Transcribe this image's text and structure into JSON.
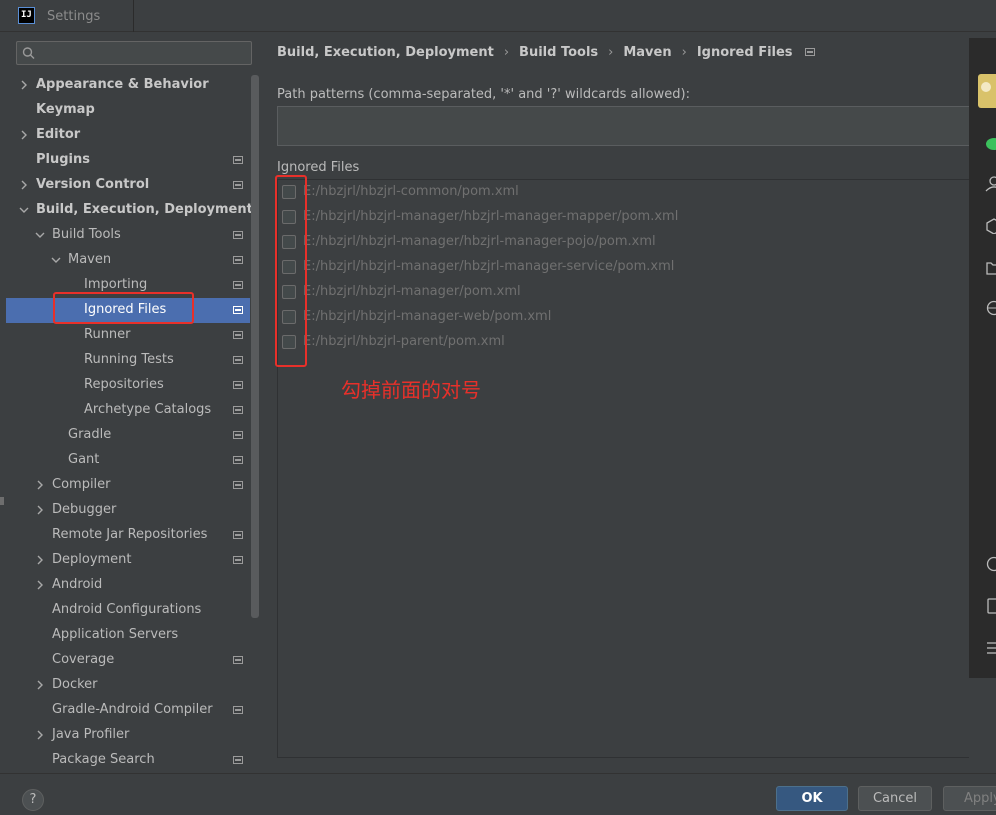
{
  "window": {
    "title": "Settings",
    "logo_text": "IJ"
  },
  "search": {
    "placeholder": "",
    "value": ""
  },
  "tree": [
    {
      "label": "Appearance & Behavior",
      "level": 0,
      "bold": true,
      "arrow": "right",
      "badge": false
    },
    {
      "label": "Keymap",
      "level": 0,
      "bold": true,
      "arrow": "",
      "badge": false
    },
    {
      "label": "Editor",
      "level": 0,
      "bold": true,
      "arrow": "right",
      "badge": false
    },
    {
      "label": "Plugins",
      "level": 0,
      "bold": true,
      "arrow": "",
      "badge": true
    },
    {
      "label": "Version Control",
      "level": 0,
      "bold": true,
      "arrow": "right",
      "badge": true
    },
    {
      "label": "Build, Execution, Deployment",
      "level": 0,
      "bold": true,
      "arrow": "down",
      "badge": false
    },
    {
      "label": "Build Tools",
      "level": 1,
      "bold": false,
      "arrow": "down",
      "badge": true
    },
    {
      "label": "Maven",
      "level": 2,
      "bold": false,
      "arrow": "down",
      "badge": true
    },
    {
      "label": "Importing",
      "level": 3,
      "bold": false,
      "arrow": "",
      "badge": true
    },
    {
      "label": "Ignored Files",
      "level": 3,
      "bold": false,
      "arrow": "",
      "badge": true,
      "selected": true
    },
    {
      "label": "Runner",
      "level": 3,
      "bold": false,
      "arrow": "",
      "badge": true
    },
    {
      "label": "Running Tests",
      "level": 3,
      "bold": false,
      "arrow": "",
      "badge": true
    },
    {
      "label": "Repositories",
      "level": 3,
      "bold": false,
      "arrow": "",
      "badge": true
    },
    {
      "label": "Archetype Catalogs",
      "level": 3,
      "bold": false,
      "arrow": "",
      "badge": true
    },
    {
      "label": "Gradle",
      "level": 2,
      "bold": false,
      "arrow": "",
      "badge": true
    },
    {
      "label": "Gant",
      "level": 2,
      "bold": false,
      "arrow": "",
      "badge": true
    },
    {
      "label": "Compiler",
      "level": 1,
      "bold": false,
      "arrow": "right",
      "badge": true
    },
    {
      "label": "Debugger",
      "level": 1,
      "bold": false,
      "arrow": "right",
      "badge": false
    },
    {
      "label": "Remote Jar Repositories",
      "level": 1,
      "bold": false,
      "arrow": "",
      "badge": true
    },
    {
      "label": "Deployment",
      "level": 1,
      "bold": false,
      "arrow": "right",
      "badge": true
    },
    {
      "label": "Android",
      "level": 1,
      "bold": false,
      "arrow": "right",
      "badge": false
    },
    {
      "label": "Android Configurations",
      "level": 1,
      "bold": false,
      "arrow": "",
      "badge": false
    },
    {
      "label": "Application Servers",
      "level": 1,
      "bold": false,
      "arrow": "",
      "badge": false
    },
    {
      "label": "Coverage",
      "level": 1,
      "bold": false,
      "arrow": "",
      "badge": true
    },
    {
      "label": "Docker",
      "level": 1,
      "bold": false,
      "arrow": "right",
      "badge": false
    },
    {
      "label": "Gradle-Android Compiler",
      "level": 1,
      "bold": false,
      "arrow": "",
      "badge": true
    },
    {
      "label": "Java Profiler",
      "level": 1,
      "bold": false,
      "arrow": "right",
      "badge": false
    },
    {
      "label": "Package Search",
      "level": 1,
      "bold": false,
      "arrow": "",
      "badge": true
    }
  ],
  "breadcrumb": {
    "items": [
      "Build, Execution, Deployment",
      "Build Tools",
      "Maven",
      "Ignored Files"
    ],
    "separator": "›"
  },
  "path_patterns": {
    "label": "Path patterns (comma-separated, '*' and '?' wildcards allowed):",
    "value": ""
  },
  "ignored_files": {
    "label": "Ignored Files",
    "items": [
      {
        "path": "E:/hbzjrl/hbzjrl-common/pom.xml",
        "checked": false
      },
      {
        "path": "E:/hbzjrl/hbzjrl-manager/hbzjrl-manager-mapper/pom.xml",
        "checked": false
      },
      {
        "path": "E:/hbzjrl/hbzjrl-manager/hbzjrl-manager-pojo/pom.xml",
        "checked": false
      },
      {
        "path": "E:/hbzjrl/hbzjrl-manager/hbzjrl-manager-service/pom.xml",
        "checked": false
      },
      {
        "path": "E:/hbzjrl/hbzjrl-manager/pom.xml",
        "checked": false
      },
      {
        "path": "E:/hbzjrl/hbzjrl-manager-web/pom.xml",
        "checked": false
      },
      {
        "path": "E:/hbzjrl/hbzjrl-parent/pom.xml",
        "checked": false
      }
    ]
  },
  "annotation": {
    "text": "勾掉前面的对号",
    "color": "#e8302a"
  },
  "buttons": {
    "help": "?",
    "ok": "OK",
    "cancel": "Cancel",
    "apply": "Apply"
  },
  "colors": {
    "selection": "#4b6eaf",
    "ok_button": "#365880",
    "highlight": "#e8302a",
    "background": "#3c3f41"
  }
}
